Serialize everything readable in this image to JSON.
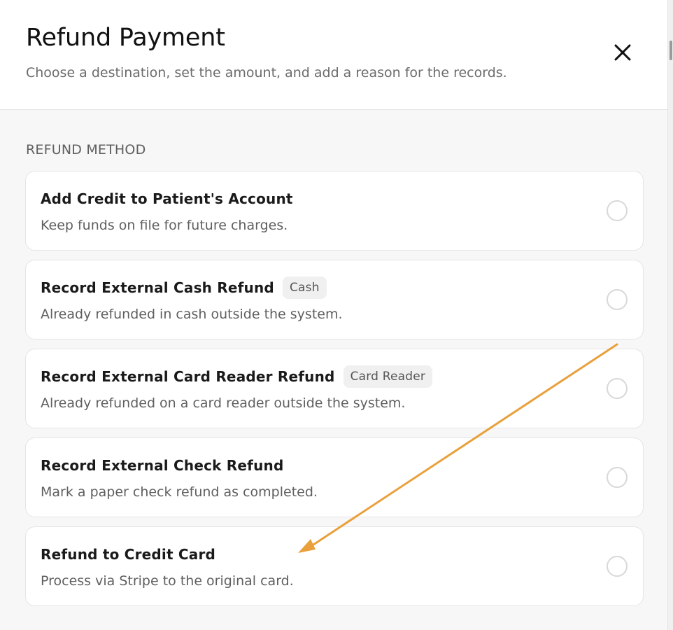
{
  "modal": {
    "title": "Refund Payment",
    "subtitle": "Choose a destination, set the amount, and add a reason for the records."
  },
  "icons": {
    "close": "close-icon",
    "radio": "radio-unselected-icon"
  },
  "refund_method": {
    "label": "REFUND METHOD",
    "options": [
      {
        "title": "Add Credit to Patient's Account",
        "badge": "",
        "description": "Keep funds on file for future charges.",
        "selected": false
      },
      {
        "title": "Record External Cash Refund",
        "badge": "Cash",
        "description": "Already refunded in cash outside the system.",
        "selected": false
      },
      {
        "title": "Record External Card Reader Refund",
        "badge": "Card Reader",
        "description": "Already refunded on a card reader outside the system.",
        "selected": false
      },
      {
        "title": "Record External Check Refund",
        "badge": "",
        "description": "Mark a paper check refund as completed.",
        "selected": false
      },
      {
        "title": "Refund to Credit Card",
        "badge": "",
        "description": "Process via Stripe to the original card.",
        "selected": false
      }
    ]
  },
  "annotation": {
    "type": "arrow",
    "color": "#e9a03b"
  }
}
